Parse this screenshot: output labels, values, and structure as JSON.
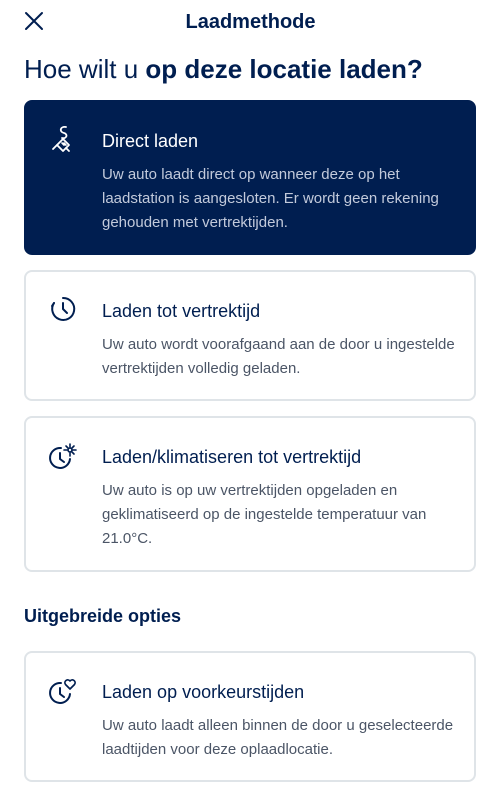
{
  "header": {
    "title": "Laadmethode",
    "close_icon": "close-icon"
  },
  "question": {
    "prefix": "Hoe wilt u ",
    "bold": "op deze locatie laden?"
  },
  "options": [
    {
      "title": "Direct laden",
      "description": "Uw auto laadt direct op wanneer deze op het laadstation is aangesloten. Er wordt geen rekening gehouden met vertrektijden.",
      "icon": "charging-plug-icon",
      "selected": true
    },
    {
      "title": "Laden tot vertrektijd",
      "description": "Uw auto wordt voorafgaand aan de door u ingestelde vertrektijden volledig geladen.",
      "icon": "clock-icon",
      "selected": false
    },
    {
      "title": "Laden/klimatiseren tot vertrektijd",
      "description": "Uw auto is op uw vertrektijden opgeladen en geklimatiseerd op de ingestelde temperatuur van 21.0°C.",
      "icon": "clock-climate-icon",
      "selected": false
    }
  ],
  "advanced": {
    "section_title": "Uitgebreide opties",
    "options": [
      {
        "title": "Laden op voorkeurstijden",
        "description": "Uw auto laadt alleen binnen de door u geselecteerde laadtijden voor deze oplaadlocatie.",
        "icon": "clock-heart-icon",
        "selected": false
      }
    ]
  },
  "colors": {
    "brand_navy": "#001e50",
    "selected_desc": "#c2cadb",
    "card_border": "#dfe4e8",
    "desc_text": "#4b5566"
  }
}
